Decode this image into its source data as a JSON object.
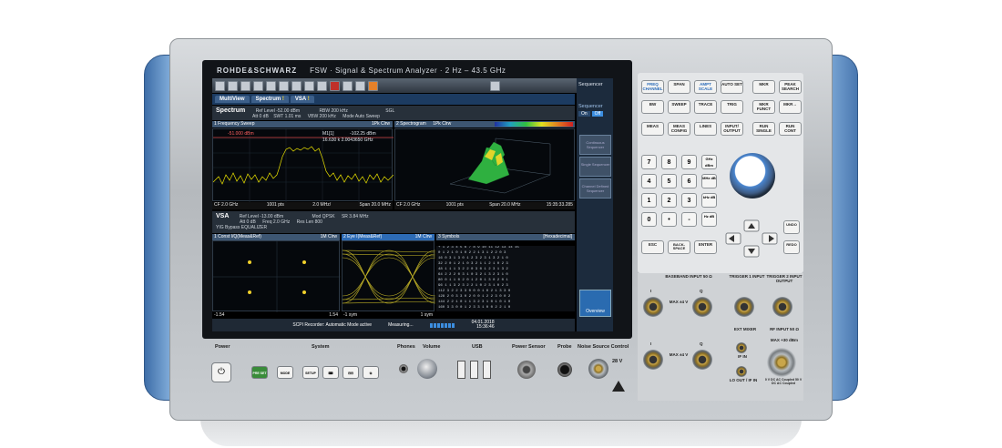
{
  "instrument": {
    "brand": "ROHDE&SCHWARZ",
    "model_title": "FSW · Signal & Spectrum Analyzer · 2 Hz – 43.5 GHz"
  },
  "screen": {
    "sequencer_title": "Sequencer",
    "sequencer_label": "Sequencer",
    "seq_on": "On",
    "seq_off": "Off",
    "tabs": [
      {
        "label": "MultiView"
      },
      {
        "label": "Spectrum"
      },
      {
        "label": "VSA"
      }
    ],
    "spectrum_info": {
      "name": "Spectrum",
      "ref_level": "Ref Level  -52.00 dBm",
      "att": "Att            0 dB",
      "swt": "SWT  1.01 ms",
      "rbw": "RBW  200 kHz",
      "vbw": "VBW  200 kHz",
      "mode": "Mode  Auto Sweep",
      "sgl": "SGL"
    },
    "freq_sweep": {
      "title": "1 Frequency Sweep",
      "trace": "1Pk Clrw",
      "marker": "M1[1]",
      "marker_level": "-102.25 dBm",
      "marker_freq": "16.630 k 2.0043650 GHz",
      "ref_line": "-51.000 dBm",
      "cf": "CF 2.0 GHz",
      "pts": "1001 pts",
      "per_div": "2.0 MHz/",
      "span": "Span 20.0 MHz"
    },
    "spectrogram": {
      "title": "2 Spectrogram",
      "trace": "1Pk Clrw",
      "cf": "CF 2.0 GHz",
      "pts": "1001 pts",
      "span": "Span 20.0 MHz",
      "time": "15:35:33.285"
    },
    "vsa_info": {
      "name": "VSA",
      "ref_level": "Ref Level  -13.00 dBm",
      "att": "Att   0 dB",
      "freq": "Freq  2.0 GHz",
      "mod": "Mod   QPSK",
      "sr": "SR  3.84 MHz",
      "res_len": "Res Len  800",
      "eq": "YIG Bypass EQUALIZER"
    },
    "const_panel": {
      "title": "1 Const I/Q(Meas&Ref)",
      "trace": "1M Clrw",
      "left": "-1.54",
      "right": "1.54"
    },
    "eye_panel": {
      "title": "2 Eye I(Meas&Ref)",
      "trace": "1M Clrw",
      "left": "-1 sym",
      "right": "1 sym"
    },
    "symbols_panel": {
      "title": "3 Symbols",
      "mode": "[Hexadecimal]"
    },
    "symbol_rows": [
      "     + 1 2 3 4 5 6 7 8 9 10 11 12 13 14 15",
      "0    1 2 1 0 1 0 2 2 1 3 1 2 2 0 3",
      "16   0 3 1 3 0 1 2 3 2 3 1 3 2 1 0",
      "32   2 0 1 2 1 0 3 2 1 1 2 1 0 2 3",
      "48   1 1 1 3 2 2 0 3 0 1 2 3 1 3 2",
      "64   2 2 2 0 3 1 0 3 2 1 3 2 3 1 0",
      "80   0 1 1 0 2 0 1 2 0 1 3 0 2 0 1",
      "96   1 1 3 2 3 2 2 1 0 2 3 1 0 2 3",
      "112  3 2 2 3 3 0 0 0 1 0 2 1 3 3 0",
      "128  2 0 3 3 0 2 0 0 1 2 2 3 0 0 2",
      "144  2 2 1 0 1 1 3 2 3 1 0 1 0 1 0",
      "160  3 3 0 0 1 2 3 3 1 0 0 2 2 1 0",
      "176  0 3 3 3 0 1 3 3 3 1 0 2 3 1 2",
      "192  1 1 0 3 2 1 2 3 0 1 1 3 2 1 0",
      "208  0 2 1 1 3 2 1 0 3 3 2 2 1 1 0"
    ],
    "overview_label": "Overview",
    "status": {
      "recorder": "SCPI Recorder: Automatic Mode active",
      "measuring": "Measuring...",
      "date": "04.01.2018",
      "time": "15:36:46"
    },
    "softkeys": [
      "Continuous Sequencer",
      "Single Sequencer",
      "Channel Defined Sequencer"
    ]
  },
  "keypad": {
    "row1": [
      "FREQ CHANNEL",
      "SPAN",
      "AMPT SCALE",
      "AUTO SET",
      "MKR",
      "PEAK SEARCH"
    ],
    "row2": [
      "BW",
      "SWEEP",
      "TRACE",
      "TRIG",
      "MKR FUNCT",
      "MKR→"
    ],
    "row3": [
      "MEAS",
      "MEAS CONFIG",
      "LINES",
      "INPUT/ OUTPUT",
      "RUN SINGLE",
      "RUN CONT"
    ],
    "numbers": [
      "7",
      "8",
      "9",
      "4",
      "5",
      "6",
      "1",
      "2",
      "3",
      "0",
      "•",
      "-"
    ],
    "units": [
      "GHz dBm",
      "MHz dB",
      "kHz dB",
      "Hz dB"
    ],
    "bottom": [
      "ESC",
      "BACK-SPACE",
      "ENTER"
    ],
    "undo": "UNDO",
    "redo": "REDO"
  },
  "ports": {
    "baseband": "BASEBAND INPUT 50 Ω",
    "trigger1": "TRIGGER 1 INPUT",
    "trigger2": "TRIGGER 2 INPUT  OUTPUT",
    "max_top": "MAX ±4 V",
    "max_bottom": "MAX ±4 V",
    "i_top": "I",
    "q_top": "Q",
    "i_bot": "I",
    "q_bot": "Q",
    "ext_mixer": "EXT MIXER",
    "rf_input": "RF INPUT 50 Ω",
    "rf_max": "MAX +30 dBm",
    "rf_note": "0 V DC AC Coupled 50 V DC AC Coupled",
    "lo_out": "LO OUT / IF IN",
    "if_in": "IF IN"
  },
  "front": {
    "power": "Power",
    "system": "System",
    "phones": "Phones",
    "volume": "Volume",
    "usb": "USB",
    "power_sensor": "Power Sensor",
    "probe": "Probe",
    "noise_source": "Noise Source Control",
    "noise_voltage": "28 V",
    "keys": [
      "PRE SET",
      "MODE",
      "SETUP",
      "⌨",
      "⊟⊟",
      "⧉"
    ]
  }
}
